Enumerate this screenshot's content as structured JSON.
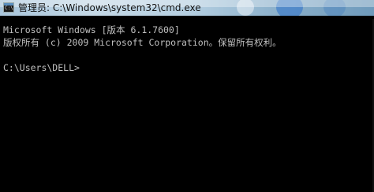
{
  "window": {
    "title": "管理员: C:\\Windows\\system32\\cmd.exe",
    "icon": "cmd-icon",
    "icon_text": "C:\\"
  },
  "console": {
    "lines": [
      "Microsoft Windows [版本 6.1.7600]",
      "版权所有 (c) 2009 Microsoft Corporation。保留所有权利。",
      "",
      "C:\\Users\\DELL>"
    ],
    "text_color": "#c0c0c0",
    "background": "#000000"
  },
  "colors": {
    "title_bar": "#b6d0e2",
    "title_text": "#111111"
  }
}
